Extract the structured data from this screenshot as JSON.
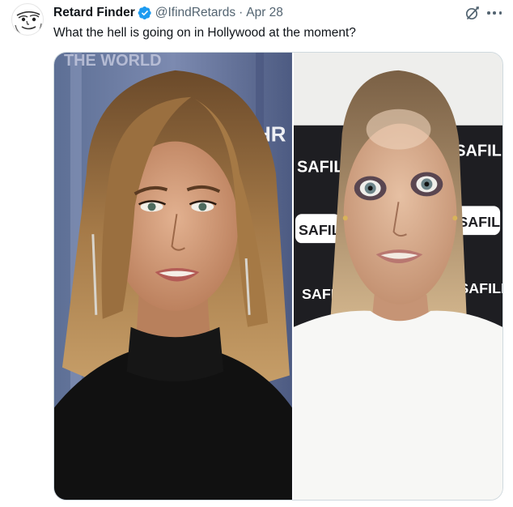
{
  "tweet": {
    "author_name": "Retard Finder",
    "handle": "@IfindRetards",
    "separator": "·",
    "date": "Apr 28",
    "text": "What the hell is going on in Hollywood at the moment?",
    "avatar_icon": "cartoon-face-avatar",
    "verified_icon": "verified-badge-icon",
    "grok_icon": "grok-icon",
    "more_icon": "more-options-icon"
  },
  "media": {
    "left_image": {
      "description_icon": "photo-woman-black-turtleneck",
      "backdrop_text": "THE WORLD",
      "backdrop_text_2": "HR"
    },
    "right_image": {
      "description_icon": "photo-woman-white-tshirt",
      "logo_text": "SAFILM"
    }
  },
  "colors": {
    "text_primary": "#0f1419",
    "text_secondary": "#536471",
    "verified_blue": "#1d9bf0",
    "border": "#cfd9de"
  }
}
